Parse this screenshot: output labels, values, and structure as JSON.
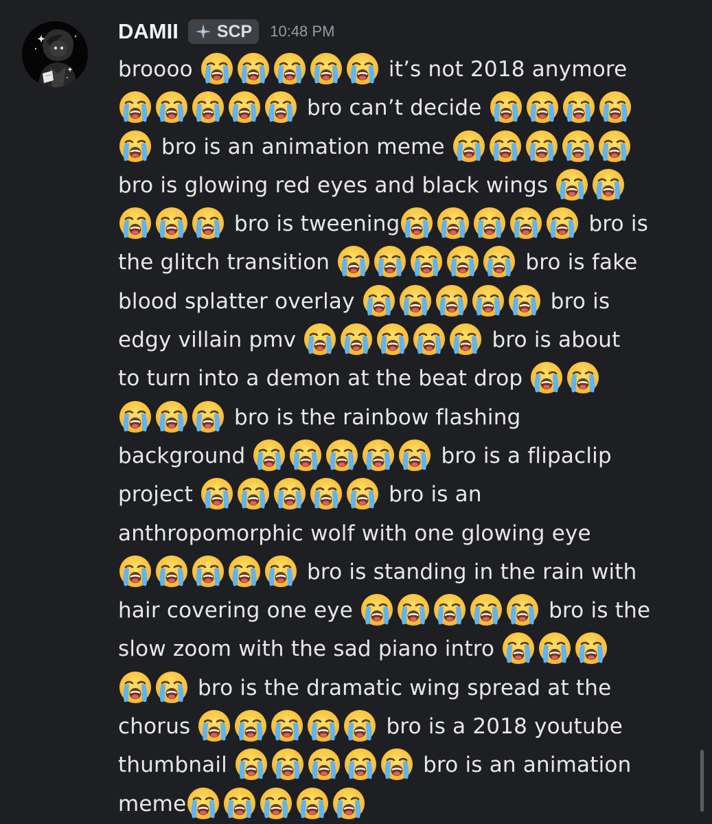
{
  "message": {
    "username": "DAMII",
    "tag": {
      "label": "SCP",
      "icon": "diamond-sparkle-icon"
    },
    "timestamp": "10:48 PM",
    "avatar": "user-avatar",
    "emoji": "loudly-crying-face",
    "lines": [
      [
        {
          "t": "broooo "
        },
        {
          "e": 5
        },
        {
          "t": " it’s not 2018 anymore"
        }
      ],
      [
        {
          "e": 5
        },
        {
          "t": " bro can’t decide "
        },
        {
          "e": 4
        }
      ],
      [
        {
          "e": 1
        },
        {
          "t": " bro is an animation meme "
        },
        {
          "e": 5
        }
      ],
      [
        {
          "t": "bro is glowing red eyes and black wings "
        },
        {
          "e": 2
        }
      ],
      [
        {
          "e": 3
        },
        {
          "t": " bro is tweening"
        },
        {
          "e": 5
        },
        {
          "t": " bro is"
        }
      ],
      [
        {
          "t": "the glitch transition "
        },
        {
          "e": 5
        },
        {
          "t": " bro is fake"
        }
      ],
      [
        {
          "t": "blood splatter overlay "
        },
        {
          "e": 5
        },
        {
          "t": " bro is"
        }
      ],
      [
        {
          "t": "edgy villain pmv "
        },
        {
          "e": 5
        },
        {
          "t": " bro is about"
        }
      ],
      [
        {
          "t": "to turn into a demon at the beat drop "
        },
        {
          "e": 2
        }
      ],
      [
        {
          "e": 3
        },
        {
          "t": " bro is the rainbow flashing"
        }
      ],
      [
        {
          "t": "background "
        },
        {
          "e": 5
        },
        {
          "t": " bro is a flipaclip"
        }
      ],
      [
        {
          "t": "project "
        },
        {
          "e": 5
        },
        {
          "t": " bro is an"
        }
      ],
      [
        {
          "t": "anthropomorphic wolf with one glowing eye"
        }
      ],
      [
        {
          "e": 5
        },
        {
          "t": " bro is standing in the rain with"
        }
      ],
      [
        {
          "t": "hair covering one eye "
        },
        {
          "e": 5
        },
        {
          "t": " bro is the"
        }
      ],
      [
        {
          "t": "slow zoom with the sad piano intro "
        },
        {
          "e": 3
        }
      ],
      [
        {
          "e": 2
        },
        {
          "t": " bro is the dramatic wing spread at the"
        }
      ],
      [
        {
          "t": "chorus "
        },
        {
          "e": 5
        },
        {
          "t": " bro is a 2018 youtube"
        }
      ],
      [
        {
          "t": "thumbnail "
        },
        {
          "e": 5
        },
        {
          "t": " bro is an animation"
        }
      ],
      [
        {
          "t": "meme"
        },
        {
          "e": 5
        }
      ]
    ]
  },
  "colors": {
    "background": "#1e1f22",
    "text": "#e8e8ea",
    "username": "#f2f3f5",
    "timestamp": "#949ba4",
    "tag_bg": "#3f4147"
  }
}
